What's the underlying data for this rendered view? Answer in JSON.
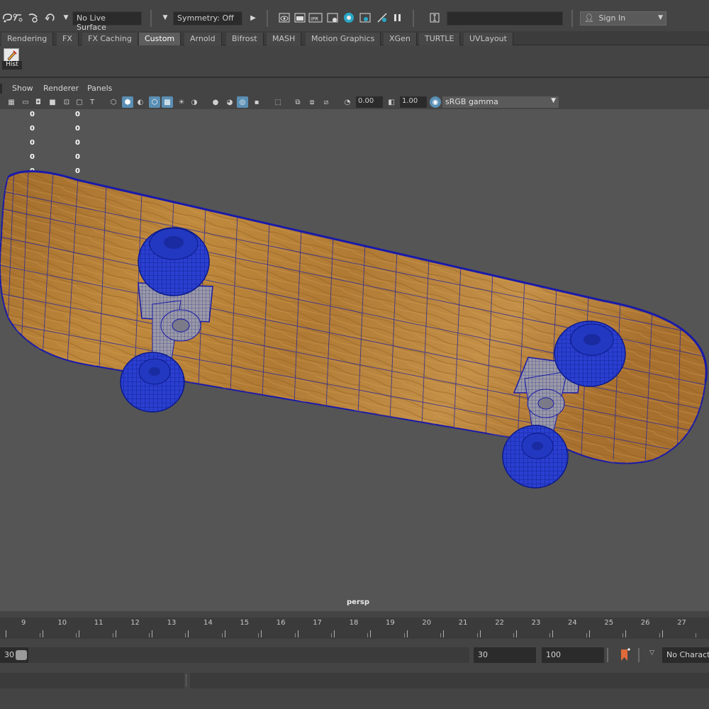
{
  "status_line": {
    "live_surface": "No Live Surface",
    "symmetry": "Symmetry: Off",
    "sign_in": "Sign In",
    "icons": [
      "lasso-select-icon",
      "paint-select-icon",
      "snap-curve-icon",
      "snap-point-icon",
      "render-view-icon",
      "render-frame-icon",
      "ipr-render-icon",
      "render-settings-icon",
      "hypershade-icon",
      "playblast-icon",
      "pause-icon"
    ]
  },
  "shelf_tabs": [
    "Rendering",
    "FX",
    "FX Caching",
    "Custom",
    "Arnold",
    "Bifrost",
    "MASH",
    "Motion Graphics",
    "XGen",
    "TURTLE",
    "UVLayout"
  ],
  "active_shelf_tab": "Custom",
  "shelf": {
    "hist_label": "Hist"
  },
  "panel_menu": [
    "Show",
    "Renderer",
    "Panels"
  ],
  "panel_toolbar": {
    "exposure": "0.00",
    "gamma": "1.00",
    "color_space": "sRGB gamma"
  },
  "viewport": {
    "hud_rows": [
      [
        "0",
        "0"
      ],
      [
        "0",
        "0"
      ],
      [
        "0",
        "0"
      ],
      [
        "0",
        "0"
      ],
      [
        "0",
        "0"
      ]
    ],
    "camera": "persp",
    "colors": {
      "background": "#555555",
      "wireframe": "#1a1aa8",
      "wheel": "#2a3fd0",
      "deck": "#b07830"
    }
  },
  "time_slider": {
    "frames": [
      "9",
      "10",
      "11",
      "12",
      "13",
      "14",
      "15",
      "16",
      "17",
      "18",
      "19",
      "20",
      "21",
      "22",
      "23",
      "24",
      "25",
      "26",
      "27"
    ]
  },
  "range_slider": {
    "start": "30",
    "end": "30",
    "max": "100",
    "character_set": "No Characte"
  }
}
